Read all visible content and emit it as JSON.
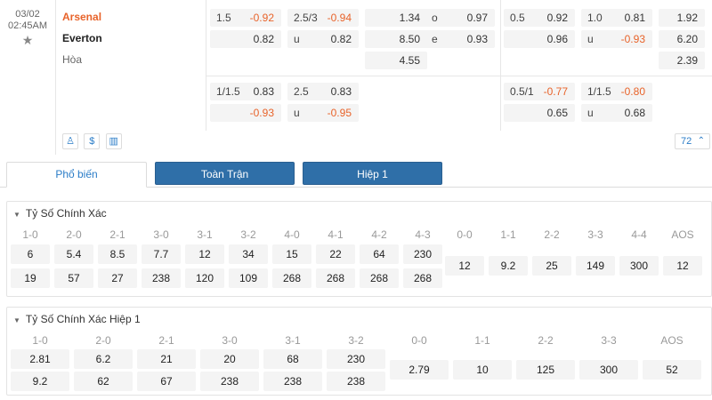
{
  "match": {
    "date": "03/02",
    "time": "02:45AM",
    "star": "★",
    "home": "Arsenal",
    "away": "Everton",
    "draw": "Hòa",
    "ft_row1": [
      {
        "l": "1.5",
        "v": "-0.92"
      },
      {
        "l": "2.5/3",
        "v": "-0.94"
      },
      {
        "l": "",
        "v": "1.34"
      },
      {
        "l": "o",
        "v": "0.97"
      },
      {
        "l": "0.5",
        "v": "0.92"
      },
      {
        "l": "1.0",
        "v": "0.81"
      },
      {
        "l": "",
        "v": "1.92"
      }
    ],
    "ft_row2": [
      {
        "l": "",
        "v": "0.82"
      },
      {
        "l": "u",
        "v": "0.82"
      },
      {
        "l": "",
        "v": "8.50"
      },
      {
        "l": "e",
        "v": "0.93"
      },
      {
        "l": "",
        "v": "0.96"
      },
      {
        "l": "u",
        "v": "-0.93"
      },
      {
        "l": "",
        "v": "6.20"
      }
    ],
    "ft_row3": [
      {
        "l": "",
        "v": "4.55"
      },
      {
        "l": "",
        "v": "2.39"
      }
    ],
    "alt_row1": [
      {
        "l": "1/1.5",
        "v": "0.83"
      },
      {
        "l": "2.5",
        "v": "0.83"
      },
      {
        "l": "0.5/1",
        "v": "-0.77"
      },
      {
        "l": "1/1.5",
        "v": "-0.80"
      }
    ],
    "alt_row2": [
      {
        "l": "",
        "v": "-0.93"
      },
      {
        "l": "u",
        "v": "-0.95"
      },
      {
        "l": "",
        "v": "0.65"
      },
      {
        "l": "u",
        "v": "0.68"
      }
    ],
    "tools": [
      "♙",
      "$",
      "▥"
    ],
    "more_count": "72",
    "more_chevron": "⌃"
  },
  "tabs": [
    "Phổ biến",
    "Toàn Trận",
    "Hiệp 1"
  ],
  "correct_score": {
    "title": "Tỷ Số Chính Xác",
    "toggle": "▼",
    "headers_left": [
      "1-0",
      "2-0",
      "2-1",
      "3-0",
      "3-1",
      "3-2",
      "4-0",
      "4-1",
      "4-2",
      "4-3"
    ],
    "row1_left": [
      "6",
      "5.4",
      "8.5",
      "7.7",
      "12",
      "34",
      "15",
      "22",
      "64",
      "230"
    ],
    "row2_left": [
      "19",
      "57",
      "27",
      "238",
      "120",
      "109",
      "268",
      "268",
      "268",
      "268"
    ],
    "headers_right": [
      "0-0",
      "1-1",
      "2-2",
      "3-3",
      "4-4",
      "AOS"
    ],
    "row_right": [
      "12",
      "9.2",
      "25",
      "149",
      "300",
      "12"
    ]
  },
  "correct_score_h1": {
    "title": "Tỷ Số Chính Xác Hiệp 1",
    "toggle": "▼",
    "headers_left": [
      "1-0",
      "2-0",
      "2-1",
      "3-0",
      "3-1",
      "3-2"
    ],
    "row1_left": [
      "2.81",
      "6.2",
      "21",
      "20",
      "68",
      "230"
    ],
    "row2_left": [
      "9.2",
      "62",
      "67",
      "238",
      "238",
      "238"
    ],
    "headers_right": [
      "0-0",
      "1-1",
      "2-2",
      "3-3",
      "AOS"
    ],
    "row_right": [
      "2.79",
      "10",
      "125",
      "300",
      "52"
    ]
  }
}
